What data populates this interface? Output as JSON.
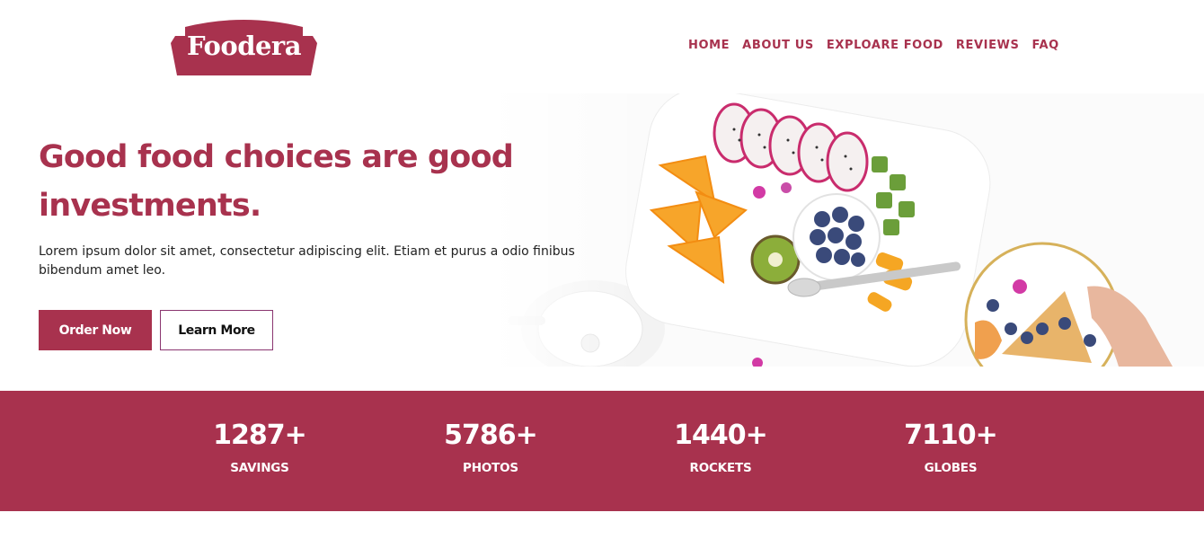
{
  "brand": {
    "name": "Foodera",
    "color": "#a8324e"
  },
  "nav": {
    "items": [
      "HOME",
      "ABOUT US",
      "EXPLOARE FOOD",
      "REVIEWS",
      "FAQ"
    ]
  },
  "hero": {
    "title": "Good food choices are good investments.",
    "description": "Lorem ipsum dolor sit amet, consectetur adipiscing elit. Etiam et purus a odio finibus bibendum amet leo.",
    "primary_button": "Order Now",
    "secondary_button": "Learn More",
    "image": "fruit-platter-photo"
  },
  "stats": [
    {
      "value": "1287+",
      "label": "SAVINGS"
    },
    {
      "value": "5786+",
      "label": "PHOTOS"
    },
    {
      "value": "1440+",
      "label": "ROCKETS"
    },
    {
      "value": "7110+",
      "label": "GLOBES"
    }
  ]
}
